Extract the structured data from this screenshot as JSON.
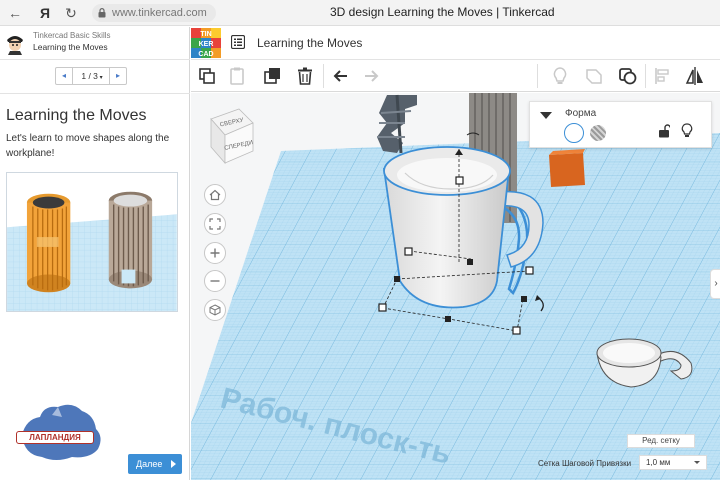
{
  "browser": {
    "url": "www.tinkercad.com",
    "window_title": "3D design Learning the Moves | Tinkercad"
  },
  "lesson": {
    "course": "Tinkercad Basic Skills",
    "name": "Learning the Moves",
    "pager": "1 / 3",
    "title": "Learning the Moves",
    "description": "Let's learn to move shapes along the workplane!",
    "next_button": "Далее"
  },
  "watermark": {
    "text": "ЛАПЛАНДИЯ"
  },
  "app": {
    "logo_letters": [
      "TIN",
      "KER",
      "CAD"
    ],
    "design_title": "Learning the Moves"
  },
  "view_cube": {
    "top": "СВЕРХУ",
    "front": "СПЕРЕДИ"
  },
  "shape_panel": {
    "label": "Форма"
  },
  "workplane": {
    "label": "Рабоч. плоск-ть",
    "edit_grid": "Ред. сетку",
    "snap_label": "Сетка Шаговой Привязки",
    "snap_value": "1,0 мм"
  },
  "colors": {
    "grid": "#8fc7e8",
    "grid_bg": "#bfe2f5",
    "accent_blue": "#3c8fd6",
    "orange_cube": "#d8651f",
    "mug": "#ebebeb"
  }
}
